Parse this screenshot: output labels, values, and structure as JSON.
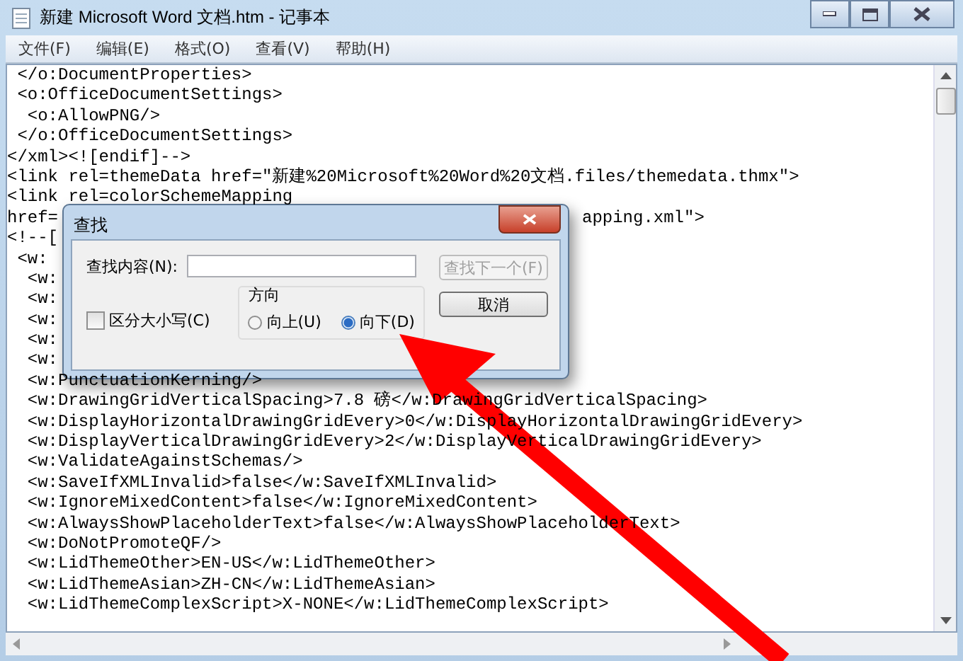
{
  "window": {
    "title": "新建 Microsoft Word 文档.htm - 记事本"
  },
  "menu": [
    "文件(F)",
    "编辑(E)",
    "格式(O)",
    "查看(V)",
    "帮助(H)"
  ],
  "lines": [
    {
      "text": " </o:DocumentProperties>"
    },
    {
      "text": " <o:OfficeDocumentSettings>"
    },
    {
      "text": "  <o:AllowPNG/>"
    },
    {
      "text": " </o:OfficeDocumentSettings>"
    },
    {
      "text": "</xml><![endif]-->"
    },
    {
      "text": "<link rel=themeData href=\"新建%20Microsoft%20Word%20文档.files/themedata.thmx\">"
    },
    {
      "text": "<link rel=colorSchemeMapping"
    },
    {
      "text": "href=",
      "tail": "apping.xml\">"
    },
    {
      "text": "<!--["
    },
    {
      "text": " <w:"
    },
    {
      "text": "  <w:"
    },
    {
      "text": "  <w:"
    },
    {
      "text": "  <w:"
    },
    {
      "text": "  <w:"
    },
    {
      "text": "  <w:"
    },
    {
      "text": "  <w:PunctuationKerning/>"
    },
    {
      "text": "  <w:DrawingGridVerticalSpacing>7.8 磅</w:DrawingGridVerticalSpacing>"
    },
    {
      "text": "  <w:DisplayHorizontalDrawingGridEvery>0</w:DisplayHorizontalDrawingGridEvery>"
    },
    {
      "text": "  <w:DisplayVerticalDrawingGridEvery>2</w:DisplayVerticalDrawingGridEvery>"
    },
    {
      "text": "  <w:ValidateAgainstSchemas/>"
    },
    {
      "text": "  <w:SaveIfXMLInvalid>false</w:SaveIfXMLInvalid>"
    },
    {
      "text": "  <w:IgnoreMixedContent>false</w:IgnoreMixedContent>"
    },
    {
      "text": "  <w:AlwaysShowPlaceholderText>false</w:AlwaysShowPlaceholderText>"
    },
    {
      "text": "  <w:DoNotPromoteQF/>"
    },
    {
      "text": "  <w:LidThemeOther>EN-US</w:LidThemeOther>"
    },
    {
      "text": "  <w:LidThemeAsian>ZH-CN</w:LidThemeAsian>"
    },
    {
      "text": "  <w:LidThemeComplexScript>X-NONE</w:LidThemeComplexScript>"
    }
  ],
  "dialog": {
    "title": "查找",
    "find_label": "查找内容(N):",
    "buttons": [
      {
        "label": "查找下一个(F)",
        "disabled": true
      },
      {
        "label": "取消",
        "disabled": false
      }
    ],
    "match_case": {
      "label": "区分大小写(C)",
      "checked": false
    },
    "direction": {
      "label": "方向",
      "options": [
        {
          "label": "向上(U)",
          "selected": false
        },
        {
          "label": "向下(D)",
          "selected": true
        }
      ]
    }
  }
}
